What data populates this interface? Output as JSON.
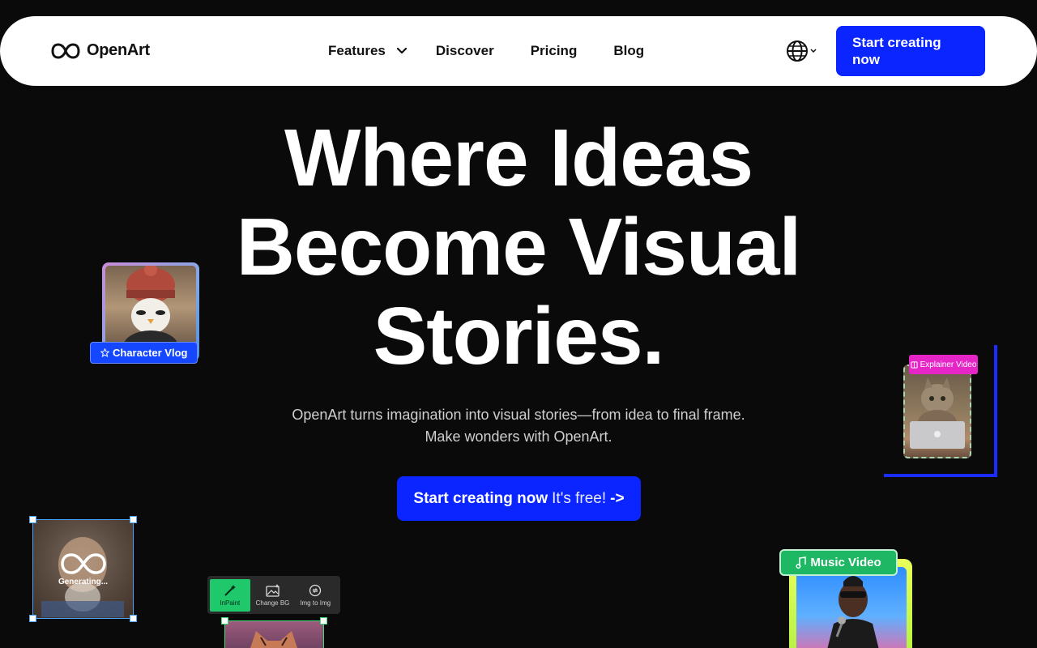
{
  "nav": {
    "logo_text": "OpenArt",
    "links": [
      {
        "label": "Features"
      },
      {
        "label": "Discover"
      },
      {
        "label": "Pricing"
      },
      {
        "label": "Blog"
      }
    ],
    "cta_label": "Start creating now"
  },
  "hero": {
    "title_line1": "Where Ideas",
    "title_line2": "Become Visual",
    "title_line3": "Stories.",
    "subtitle_line1": "OpenArt turns imagination into visual stories—from idea to final frame.",
    "subtitle_line2": "Make wonders with OpenArt.",
    "cta_strong": "Start creating now",
    "cta_light": "It's free!",
    "cta_arrow": "->"
  },
  "cards": {
    "character_vlog": "Character Vlog",
    "explainer_video": "Explainer Video",
    "generating": "Generating...",
    "music_video": "Music Video"
  },
  "toolbar": {
    "tools": [
      {
        "label": "InPaint"
      },
      {
        "label": "Change BG"
      },
      {
        "label": "Img to Img"
      }
    ]
  },
  "colors": {
    "accent": "#0a25ff",
    "background": "#0a0a0a",
    "inpaint_active": "#1ec86b",
    "music_badge": "#1eb763",
    "explainer_badge": "#e625c7"
  },
  "icons": {
    "logo": "infinity-logo-icon",
    "features_chevron": "chevron-down-icon",
    "language": "globe-icon",
    "vlog_badge": "star-icon",
    "explainer_badge": "book-icon",
    "music_badge": "music-note-icon",
    "inpaint": "magic-wand-icon",
    "change_bg": "image-icon",
    "img_to_img": "swap-icon"
  }
}
